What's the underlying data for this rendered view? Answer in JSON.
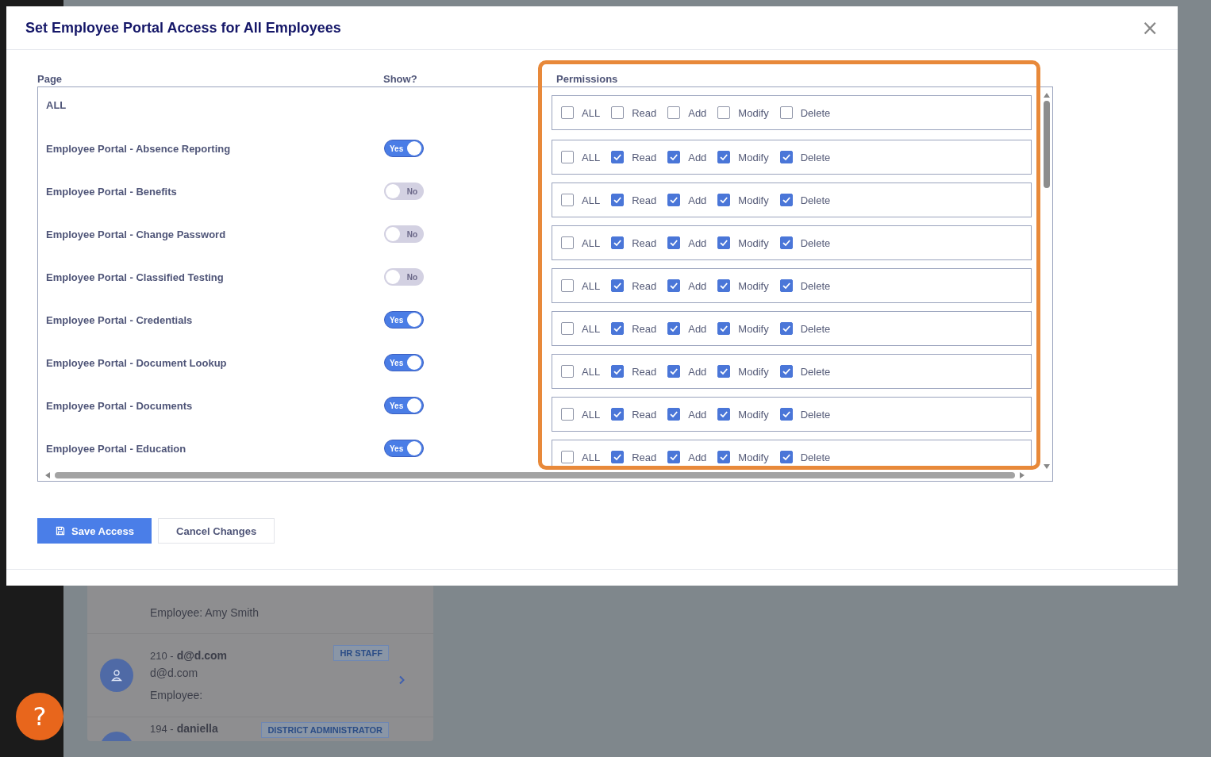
{
  "background_list": {
    "items": [
      {
        "detail": "Employee: Amy Smith"
      },
      {
        "prefix": "210 -",
        "name": "d@d.com",
        "email": "d@d.com",
        "detail": "Employee:",
        "badge": "HR STAFF"
      },
      {
        "prefix": "194 -",
        "name": "daniella",
        "badge": "DISTRICT ADMINISTRATOR"
      }
    ]
  },
  "help_button": "?",
  "dialog": {
    "title": "Set Employee Portal Access for All Employees",
    "close": "×",
    "columns": [
      "Page",
      "Show?",
      "Permissions"
    ],
    "rows": [
      {
        "kind": "all",
        "page": "ALL",
        "permissions": [
          {
            "label": "ALL",
            "checked": false
          },
          {
            "label": "Read",
            "checked": false
          },
          {
            "label": "Add",
            "checked": false
          },
          {
            "label": "Modify",
            "checked": false
          },
          {
            "label": "Delete",
            "checked": false
          }
        ]
      },
      {
        "kind": "page",
        "page": "Employee Portal - Absence Reporting",
        "show": true,
        "toggle_label": "Yes",
        "permissions": [
          {
            "label": "ALL",
            "checked": false
          },
          {
            "label": "Read",
            "checked": true
          },
          {
            "label": "Add",
            "checked": true
          },
          {
            "label": "Modify",
            "checked": true
          },
          {
            "label": "Delete",
            "checked": true
          }
        ]
      },
      {
        "kind": "page",
        "page": "Employee Portal - Benefits",
        "show": false,
        "toggle_label": "No",
        "permissions": [
          {
            "label": "ALL",
            "checked": false
          },
          {
            "label": "Read",
            "checked": true
          },
          {
            "label": "Add",
            "checked": true
          },
          {
            "label": "Modify",
            "checked": true
          },
          {
            "label": "Delete",
            "checked": true
          }
        ]
      },
      {
        "kind": "page",
        "page": "Employee Portal - Change Password",
        "show": false,
        "toggle_label": "No",
        "permissions": [
          {
            "label": "ALL",
            "checked": false
          },
          {
            "label": "Read",
            "checked": true
          },
          {
            "label": "Add",
            "checked": true
          },
          {
            "label": "Modify",
            "checked": true
          },
          {
            "label": "Delete",
            "checked": true
          }
        ]
      },
      {
        "kind": "page",
        "page": "Employee Portal - Classified Testing",
        "show": false,
        "toggle_label": "No",
        "permissions": [
          {
            "label": "ALL",
            "checked": false
          },
          {
            "label": "Read",
            "checked": true
          },
          {
            "label": "Add",
            "checked": true
          },
          {
            "label": "Modify",
            "checked": true
          },
          {
            "label": "Delete",
            "checked": true
          }
        ]
      },
      {
        "kind": "page",
        "page": "Employee Portal - Credentials",
        "show": true,
        "toggle_label": "Yes",
        "permissions": [
          {
            "label": "ALL",
            "checked": false
          },
          {
            "label": "Read",
            "checked": true
          },
          {
            "label": "Add",
            "checked": true
          },
          {
            "label": "Modify",
            "checked": true
          },
          {
            "label": "Delete",
            "checked": true
          }
        ]
      },
      {
        "kind": "page",
        "page": "Employee Portal - Document Lookup",
        "show": true,
        "toggle_label": "Yes",
        "permissions": [
          {
            "label": "ALL",
            "checked": false
          },
          {
            "label": "Read",
            "checked": true
          },
          {
            "label": "Add",
            "checked": true
          },
          {
            "label": "Modify",
            "checked": true
          },
          {
            "label": "Delete",
            "checked": true
          }
        ]
      },
      {
        "kind": "page",
        "page": "Employee Portal - Documents",
        "show": true,
        "toggle_label": "Yes",
        "permissions": [
          {
            "label": "ALL",
            "checked": false
          },
          {
            "label": "Read",
            "checked": true
          },
          {
            "label": "Add",
            "checked": true
          },
          {
            "label": "Modify",
            "checked": true
          },
          {
            "label": "Delete",
            "checked": true
          }
        ]
      },
      {
        "kind": "page",
        "page": "Employee Portal - Education",
        "show": true,
        "toggle_label": "Yes",
        "permissions": [
          {
            "label": "ALL",
            "checked": false
          },
          {
            "label": "Read",
            "checked": true
          },
          {
            "label": "Add",
            "checked": true
          },
          {
            "label": "Modify",
            "checked": true
          },
          {
            "label": "Delete",
            "checked": true
          }
        ]
      }
    ],
    "buttons": [
      {
        "kind": "primary",
        "label": "Save Access"
      },
      {
        "kind": "secondary",
        "label": "Cancel Changes"
      }
    ]
  }
}
